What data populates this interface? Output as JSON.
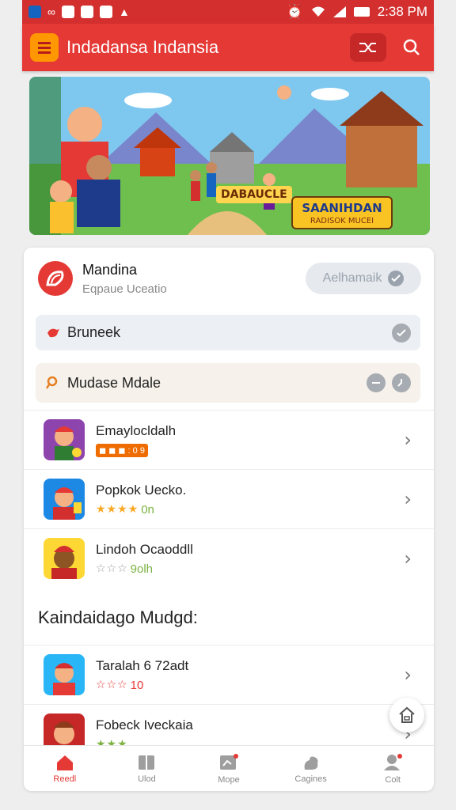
{
  "status_bar": {
    "time": "2:38 PM",
    "icons": [
      "app-icon",
      "infinity-icon",
      "news-icon",
      "game-icon",
      "camera-icon",
      "nav-icon",
      "alarm-icon",
      "wifi-icon",
      "signal-icon",
      "battery-icon"
    ]
  },
  "app_bar": {
    "title": "Indadansa Indansia",
    "logo_icon": "menu-logo-icon",
    "actions": [
      "shuffle-icon",
      "search-icon"
    ],
    "accent": "#e53935"
  },
  "banner": {
    "title": "DABAUCLE",
    "badge_main": "SAANIHDAN",
    "badge_sub": "RADISOK MUCEI"
  },
  "profile": {
    "name": "Mandina",
    "subtitle": "Eqpaue Uceatio",
    "button_label": "Aelhamaik"
  },
  "rows": [
    {
      "label": "Bruneek",
      "icon": "bird-icon"
    },
    {
      "label": "Mudase Mdale",
      "icon": "magnifier-icon"
    }
  ],
  "games": [
    {
      "title": "Emaylocldalh",
      "meta": "◼ ◼ ◼ : 0 9",
      "meta_color": "#ef6c00",
      "stars": "",
      "icon_bg": "#8e44ad"
    },
    {
      "title": "Popkok Uecko.",
      "meta": "0n",
      "meta_color": "#7cb342",
      "stars": "★★★★",
      "icon_bg": "#1e88e5"
    },
    {
      "title": "Lindoh Ocaoddll",
      "meta": "9olh",
      "meta_color": "#7cb342",
      "stars": "☆☆☆",
      "icon_bg": "#fdd835"
    }
  ],
  "section": {
    "title": "Kaindaidago Mudgd:"
  },
  "more_games": [
    {
      "title": "Taralah 6 72adt",
      "meta": "10",
      "meta_color": "#e53935",
      "stars": "☆☆☆",
      "icon_bg": "#29b6f6"
    },
    {
      "title": "Fobeck Iveckaia",
      "meta": "",
      "meta_color": "#7cb342",
      "stars": "★★★",
      "icon_bg": "#c62828"
    }
  ],
  "bottom_nav": [
    {
      "label": "Reedl",
      "icon": "home-icon",
      "active": true
    },
    {
      "label": "Ulod",
      "icon": "book-icon",
      "active": false
    },
    {
      "label": "Mope",
      "icon": "map-icon",
      "active": false
    },
    {
      "label": "Cagines",
      "icon": "puzzle-icon",
      "active": false
    },
    {
      "label": "Colt",
      "icon": "profile-icon",
      "active": false
    }
  ]
}
